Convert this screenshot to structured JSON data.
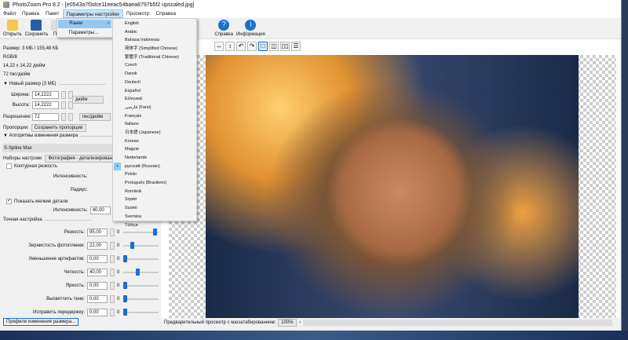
{
  "window": {
    "title": "PhotoZoom Pro 8.2 - [e0543a7f3dce11eeac54baea8797b5f2 upscaled.jpg]"
  },
  "menu": [
    "Файл",
    "Правка",
    "Пакет",
    "Параметры настройки",
    "Просмотр",
    "Справка"
  ],
  "toolbar": {
    "open": "Открыть",
    "save": "Сохранить",
    "p": "П...",
    "help": "Справка",
    "info": "Информация"
  },
  "settings_menu": {
    "languages": "Языки",
    "params": "Параметры..."
  },
  "languages": [
    "English",
    "Arabic",
    "Bahasa Indonesia",
    "简体字 (Simplified Chinese)",
    "繁體字 (Traditional Chinese)",
    "Czech",
    "Dansk",
    "Deutsch",
    "Español",
    "Ελληνικά",
    "فارسی (Farsi)",
    "Français",
    "Italiano",
    "日本語 (Japanese)",
    "Korean",
    "Magyar",
    "Nederlands",
    "русский (Russian)",
    "Polski",
    "Português (Brasileiro)",
    "Română",
    "Srpski",
    "Suomi",
    "Svenska",
    "Türkçe"
  ],
  "selected_language": "русский (Russian)",
  "info": {
    "size": "Размер: 3 МБ / 155,48 КБ",
    "mode": "RGB/8",
    "dims": "14,22 x 14,22 дюйм",
    "res": "72 пкс/дюйм"
  },
  "new_size": {
    "header": "Новый размер (3 МБ)",
    "width_label": "Ширина:",
    "width": "14,2222",
    "height_label": "Высота:",
    "height": "14,2222",
    "unit": "дюйм",
    "res_label": "Разрешение:",
    "res": "72",
    "res_unit": "пкс/дюйм",
    "prop_label": "Пропорции:",
    "prop": "Сохранить пропорции"
  },
  "algo": {
    "header": "Алгоритмы изменения размера",
    "method": "S-Spline Max",
    "preset_label": "Наборы настроек:",
    "preset": "Фотография - детализированная",
    "contour": "Контурная резкость",
    "intensity": "Интенсивность:",
    "radius": "Радиус:",
    "show_details": "Показать мелкие детали",
    "detail_intensity": "40,00"
  },
  "fine": {
    "header": "Точная настройка",
    "min": "0",
    "max": "1",
    "rows": [
      {
        "label": "Резкость:",
        "value": "95,00",
        "pos": 0.95
      },
      {
        "label": "Зернистость фотопленки:",
        "value": "22,00",
        "pos": 0.22
      },
      {
        "label": "Уменьшение артефактов:",
        "value": "0,00",
        "pos": 0
      },
      {
        "label": "Четкость:",
        "value": "40,00",
        "pos": 0.4
      },
      {
        "label": "Яркость:",
        "value": "0,00",
        "pos": 0
      },
      {
        "label": "Высветлить тени:",
        "value": "0,00",
        "pos": 0
      },
      {
        "label": "Исправить передержку:",
        "value": "0,00",
        "pos": 0
      }
    ]
  },
  "profiles_button": "Профили изменения размера...",
  "status": {
    "preview_label": "Предварительный просмотр с масштабированием:",
    "zoom": "100%"
  }
}
